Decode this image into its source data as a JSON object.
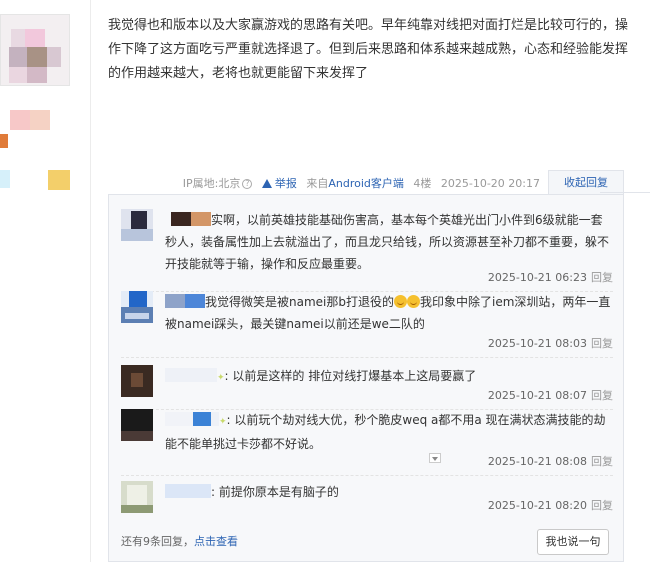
{
  "post": {
    "text": "我觉得也和版本以及大家赢游戏的思路有关吧。早年纯靠对线把对面打烂是比较可行的，操作下降了这方面吃亏严重就选择退了。但到后来思路和体系越来越成熟，心态和经验能发挥的作用越来越大，老将也就更能留下来发挥了",
    "ip_location": "IP属地:北京",
    "report_label": "举报",
    "client_label": "来自Android客户端",
    "floor": "4楼",
    "time": "2025-10-20 20:17",
    "collapse_label": "收起回复"
  },
  "replies": [
    {
      "text": "实啊，以前英雄技能基础伤害高，基本每个英雄光出门小件到6级就能一套秒人，装备属性加上去就溢出了，而且龙只给钱，所以资源甚至补刀都不重要，躲不开技能就等于输，操作和反应最重要。",
      "time": "2025-10-21 06:23",
      "reply_label": "回复"
    },
    {
      "text_a": "我觉得微笑是被namei那b打退役的",
      "text_b": "我印象中除了iem深圳站，两年一直被namei踩头，最关键namei以前还是we二队的",
      "time": "2025-10-21 08:03",
      "reply_label": "回复"
    },
    {
      "text": ": 以前是这样的 排位对线打爆基本上这局要赢了",
      "time": "2025-10-21 08:07",
      "reply_label": "回复"
    },
    {
      "text": ": 以前玩个劫对线大优，秒个脆皮weq a都不用a 现在满状态满技能的劫能不能单挑过卡莎都不好说。",
      "time": "2025-10-21 08:08",
      "reply_label": "回复"
    },
    {
      "text": ": 前提你原本是有脑子的",
      "time": "2025-10-21 08:20",
      "reply_label": "回复"
    }
  ],
  "footer": {
    "more_text": "还有9条回复，",
    "more_link": "点击查看",
    "say_button": "我也说一句"
  }
}
